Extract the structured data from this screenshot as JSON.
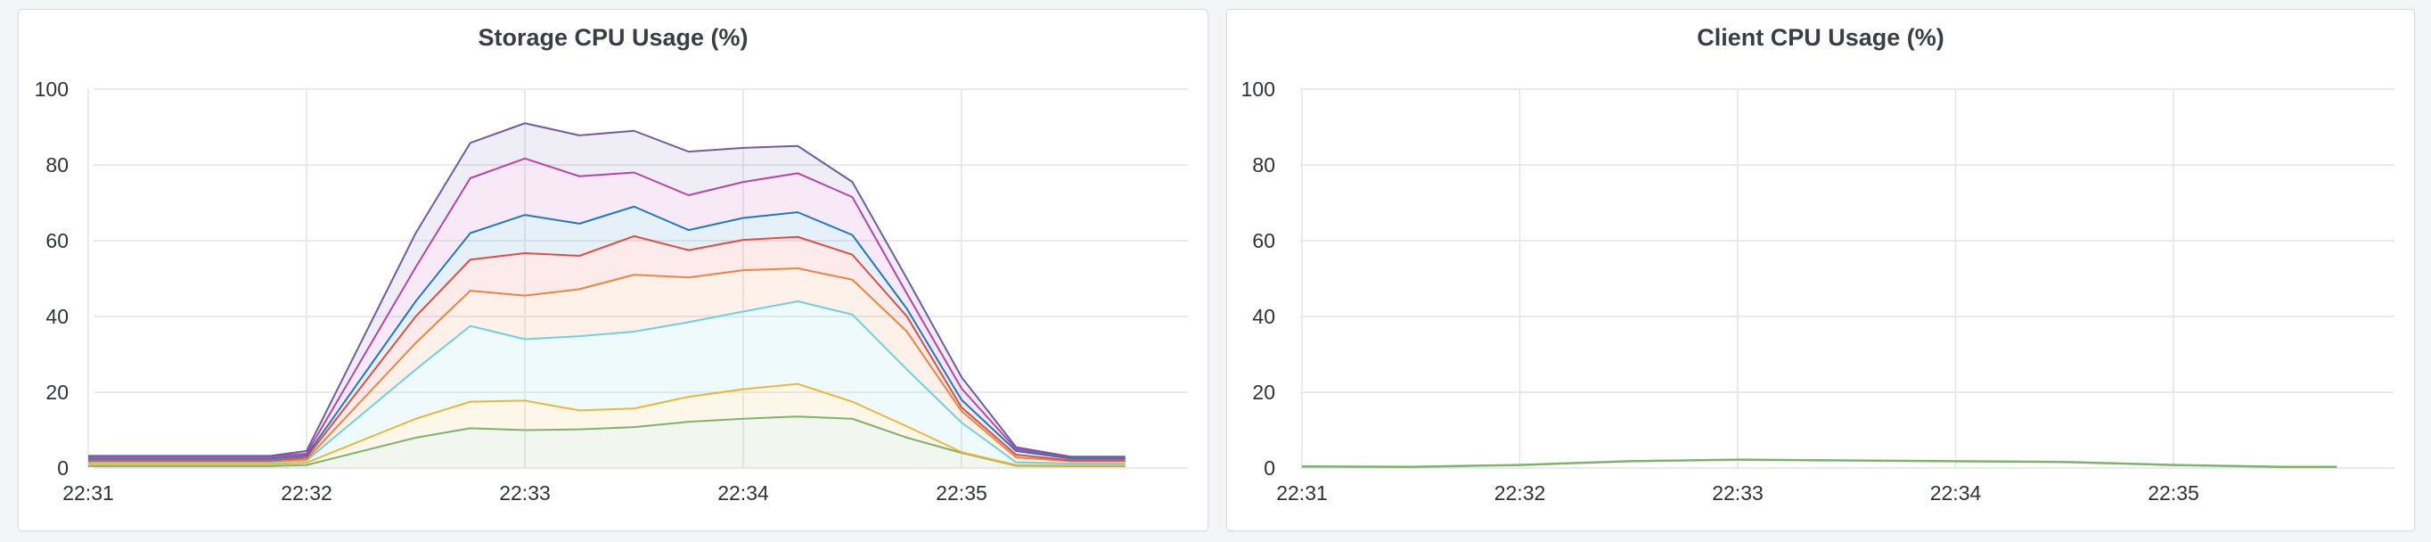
{
  "dashboard": {
    "panels": [
      {
        "title": "Storage CPU Usage (%)"
      },
      {
        "title": "Client CPU Usage (%)"
      }
    ]
  },
  "colors": {
    "grid": "#e3e4e8",
    "axis_text": "#2f3237"
  },
  "chart_data": [
    {
      "type": "area",
      "stacked": true,
      "title": "Storage CPU Usage (%)",
      "xlabel": "",
      "ylabel": "",
      "x": [
        "22:31:00",
        "22:31:30",
        "22:31:50",
        "22:32:00",
        "22:32:30",
        "22:32:45",
        "22:33:00",
        "22:33:15",
        "22:33:30",
        "22:33:45",
        "22:34:00",
        "22:34:15",
        "22:34:30",
        "22:34:45",
        "22:35:00",
        "22:35:15",
        "22:35:30",
        "22:35:45"
      ],
      "xticks": [
        "22:31",
        "22:32",
        "22:33",
        "22:34",
        "22:35"
      ],
      "yticks": [
        0,
        20,
        40,
        60,
        80,
        100
      ],
      "ylim": [
        0,
        100
      ],
      "grid": true,
      "series": [
        {
          "color": "#7eb26d",
          "values": [
            0.5,
            0.5,
            0.5,
            0.8,
            8,
            10.5,
            10,
            10.2,
            10.8,
            12.2,
            13,
            13.6,
            13,
            8,
            4,
            0.6,
            0.5,
            0.5
          ]
        },
        {
          "color": "#eab839",
          "values": [
            1,
            1,
            1,
            1.4,
            13,
            17.5,
            17.8,
            15.2,
            15.7,
            18.8,
            20.8,
            22.2,
            17.5,
            11,
            4.2,
            0.8,
            0.7,
            0.7
          ]
        },
        {
          "color": "#6ed0e0",
          "values": [
            1.5,
            1.5,
            1.5,
            2,
            26,
            37.5,
            34,
            34.8,
            36,
            38.5,
            41.3,
            44,
            40.5,
            26,
            12,
            1.5,
            1.2,
            1.2
          ]
        },
        {
          "color": "#ef843c",
          "values": [
            1.8,
            1.8,
            1.8,
            2.3,
            33,
            46.8,
            45.5,
            47.2,
            51,
            50.3,
            52.2,
            52.7,
            49.7,
            36,
            15,
            2.8,
            1.8,
            1.8
          ]
        },
        {
          "color": "#e24d42",
          "values": [
            2,
            2,
            2,
            2.8,
            40,
            55,
            56.7,
            56,
            61.2,
            57.5,
            60.2,
            61,
            56.3,
            40,
            16,
            3.5,
            2,
            2
          ]
        },
        {
          "color": "#1f78c1",
          "values": [
            2.5,
            2.5,
            2.5,
            3.3,
            44,
            62,
            66.8,
            64.5,
            69,
            62.8,
            66,
            67.5,
            61.5,
            42,
            18,
            4.5,
            2.5,
            2.5
          ]
        },
        {
          "color": "#ba43a9",
          "values": [
            3,
            3,
            3,
            3.8,
            53,
            76.5,
            81.7,
            77,
            78,
            72,
            75.5,
            77.8,
            71.5,
            46,
            21,
            5,
            2.8,
            2.8
          ]
        },
        {
          "color": "#705da0",
          "values": [
            3.2,
            3.2,
            3.2,
            4.5,
            62,
            85.8,
            91,
            87.8,
            89,
            83.5,
            84.5,
            85,
            75.5,
            50,
            24,
            5.5,
            3,
            3
          ]
        }
      ]
    },
    {
      "type": "line",
      "title": "Client CPU Usage (%)",
      "xlabel": "",
      "ylabel": "",
      "x": [
        "22:31:00",
        "22:31:30",
        "22:32:00",
        "22:32:30",
        "22:33:00",
        "22:33:30",
        "22:34:00",
        "22:34:30",
        "22:35:00",
        "22:35:30",
        "22:35:45"
      ],
      "xticks": [
        "22:31",
        "22:32",
        "22:33",
        "22:34",
        "22:35"
      ],
      "yticks": [
        0,
        20,
        40,
        60,
        80,
        100
      ],
      "ylim": [
        0,
        100
      ],
      "grid": true,
      "series": [
        {
          "color": "#7eb26d",
          "values": [
            0.4,
            0.3,
            0.8,
            1.8,
            2.2,
            2.0,
            1.8,
            1.6,
            0.8,
            0.3,
            0.3
          ]
        }
      ]
    }
  ]
}
